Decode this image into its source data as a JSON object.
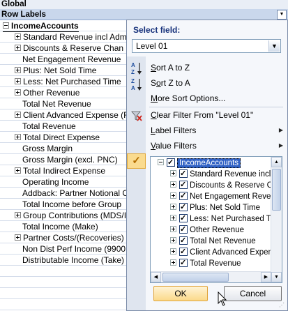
{
  "sheet": {
    "global_label": "Global",
    "row_labels_header": "Row Labels",
    "dropdown_arrow_icon": "dropdown-arrow-icon",
    "items": [
      {
        "label": "IncomeAccounts",
        "expander": "minus",
        "level": 0
      },
      {
        "label": "Standard Revenue incl Adm",
        "expander": "plus",
        "level": 1
      },
      {
        "label": "Discounts & Reserve Chan",
        "expander": "plus",
        "level": 1
      },
      {
        "label": "Net Engagement Revenue",
        "expander": "",
        "level": 1
      },
      {
        "label": "Plus: Net Sold Time",
        "expander": "plus",
        "level": 1
      },
      {
        "label": "Less: Net Purchased Time",
        "expander": "plus",
        "level": 1
      },
      {
        "label": "Other Revenue",
        "expander": "plus",
        "level": 1
      },
      {
        "label": "Total Net Revenue",
        "expander": "",
        "level": 1
      },
      {
        "label": "Client Advanced Expense (F",
        "expander": "plus",
        "level": 1
      },
      {
        "label": "Total Revenue",
        "expander": "",
        "level": 1
      },
      {
        "label": "Total Direct Expense",
        "expander": "plus",
        "level": 1
      },
      {
        "label": "Gross Margin",
        "expander": "",
        "level": 1
      },
      {
        "label": "Gross Margin (excl. PNC)",
        "expander": "",
        "level": 1
      },
      {
        "label": "Total Indirect Expense",
        "expander": "plus",
        "level": 1
      },
      {
        "label": "Operating Income",
        "expander": "",
        "level": 1
      },
      {
        "label": "Addback: Partner Notional C",
        "expander": "",
        "level": 1
      },
      {
        "label": "Total Income before Group",
        "expander": "",
        "level": 1
      },
      {
        "label": "Group Contributions (MDS/I",
        "expander": "plus",
        "level": 1
      },
      {
        "label": "Total Income (Make)",
        "expander": "",
        "level": 1
      },
      {
        "label": "Partner Costs/(Recoveries)",
        "expander": "plus",
        "level": 1
      },
      {
        "label": "Non Dist Perf Income (9900",
        "expander": "",
        "level": 1
      },
      {
        "label": "Distributable Income (Take)",
        "expander": "",
        "level": 1
      }
    ]
  },
  "popup": {
    "select_field_label": "Select field:",
    "select_value": "Level 01",
    "menu": {
      "sort_a_z": {
        "prefix": "",
        "ul": "S",
        "rest": "ort A to Z",
        "icon": "sort-a-z-icon"
      },
      "sort_z_a": {
        "prefix": "S",
        "ul": "o",
        "rest": "rt Z to A",
        "icon": "sort-z-a-icon"
      },
      "more_sort": {
        "prefix": "",
        "ul": "M",
        "rest": "ore Sort Options...",
        "icon": ""
      },
      "clear_filter": {
        "prefix": "",
        "ul": "C",
        "rest": "lear Filter From \"Level 01\"",
        "icon": "clear-filter-icon"
      },
      "label_filters": {
        "prefix": "",
        "ul": "L",
        "rest": "abel Filters",
        "icon": ""
      },
      "value_filters": {
        "prefix": "",
        "ul": "V",
        "rest": "alue Filters",
        "icon": ""
      }
    },
    "tree": [
      {
        "label": "IncomeAccounts",
        "expander": "minus",
        "level": 0,
        "selected": true
      },
      {
        "label": "Standard Revenue incl A",
        "expander": "plus",
        "level": 1
      },
      {
        "label": "Discounts & Reserve Ch",
        "expander": "plus",
        "level": 1
      },
      {
        "label": "Net Engagement Revenu",
        "expander": "plus",
        "level": 1
      },
      {
        "label": "Plus: Net Sold Time",
        "expander": "plus",
        "level": 1
      },
      {
        "label": "Less: Net Purchased Tim",
        "expander": "plus",
        "level": 1
      },
      {
        "label": "Other Revenue",
        "expander": "plus",
        "level": 1
      },
      {
        "label": "Total Net Revenue",
        "expander": "plus",
        "level": 1
      },
      {
        "label": "Client Advanced Expens",
        "expander": "plus",
        "level": 1
      },
      {
        "label": "Total Revenue",
        "expander": "plus",
        "level": 1
      }
    ],
    "ok_label": "OK",
    "cancel_label": "Cancel"
  }
}
